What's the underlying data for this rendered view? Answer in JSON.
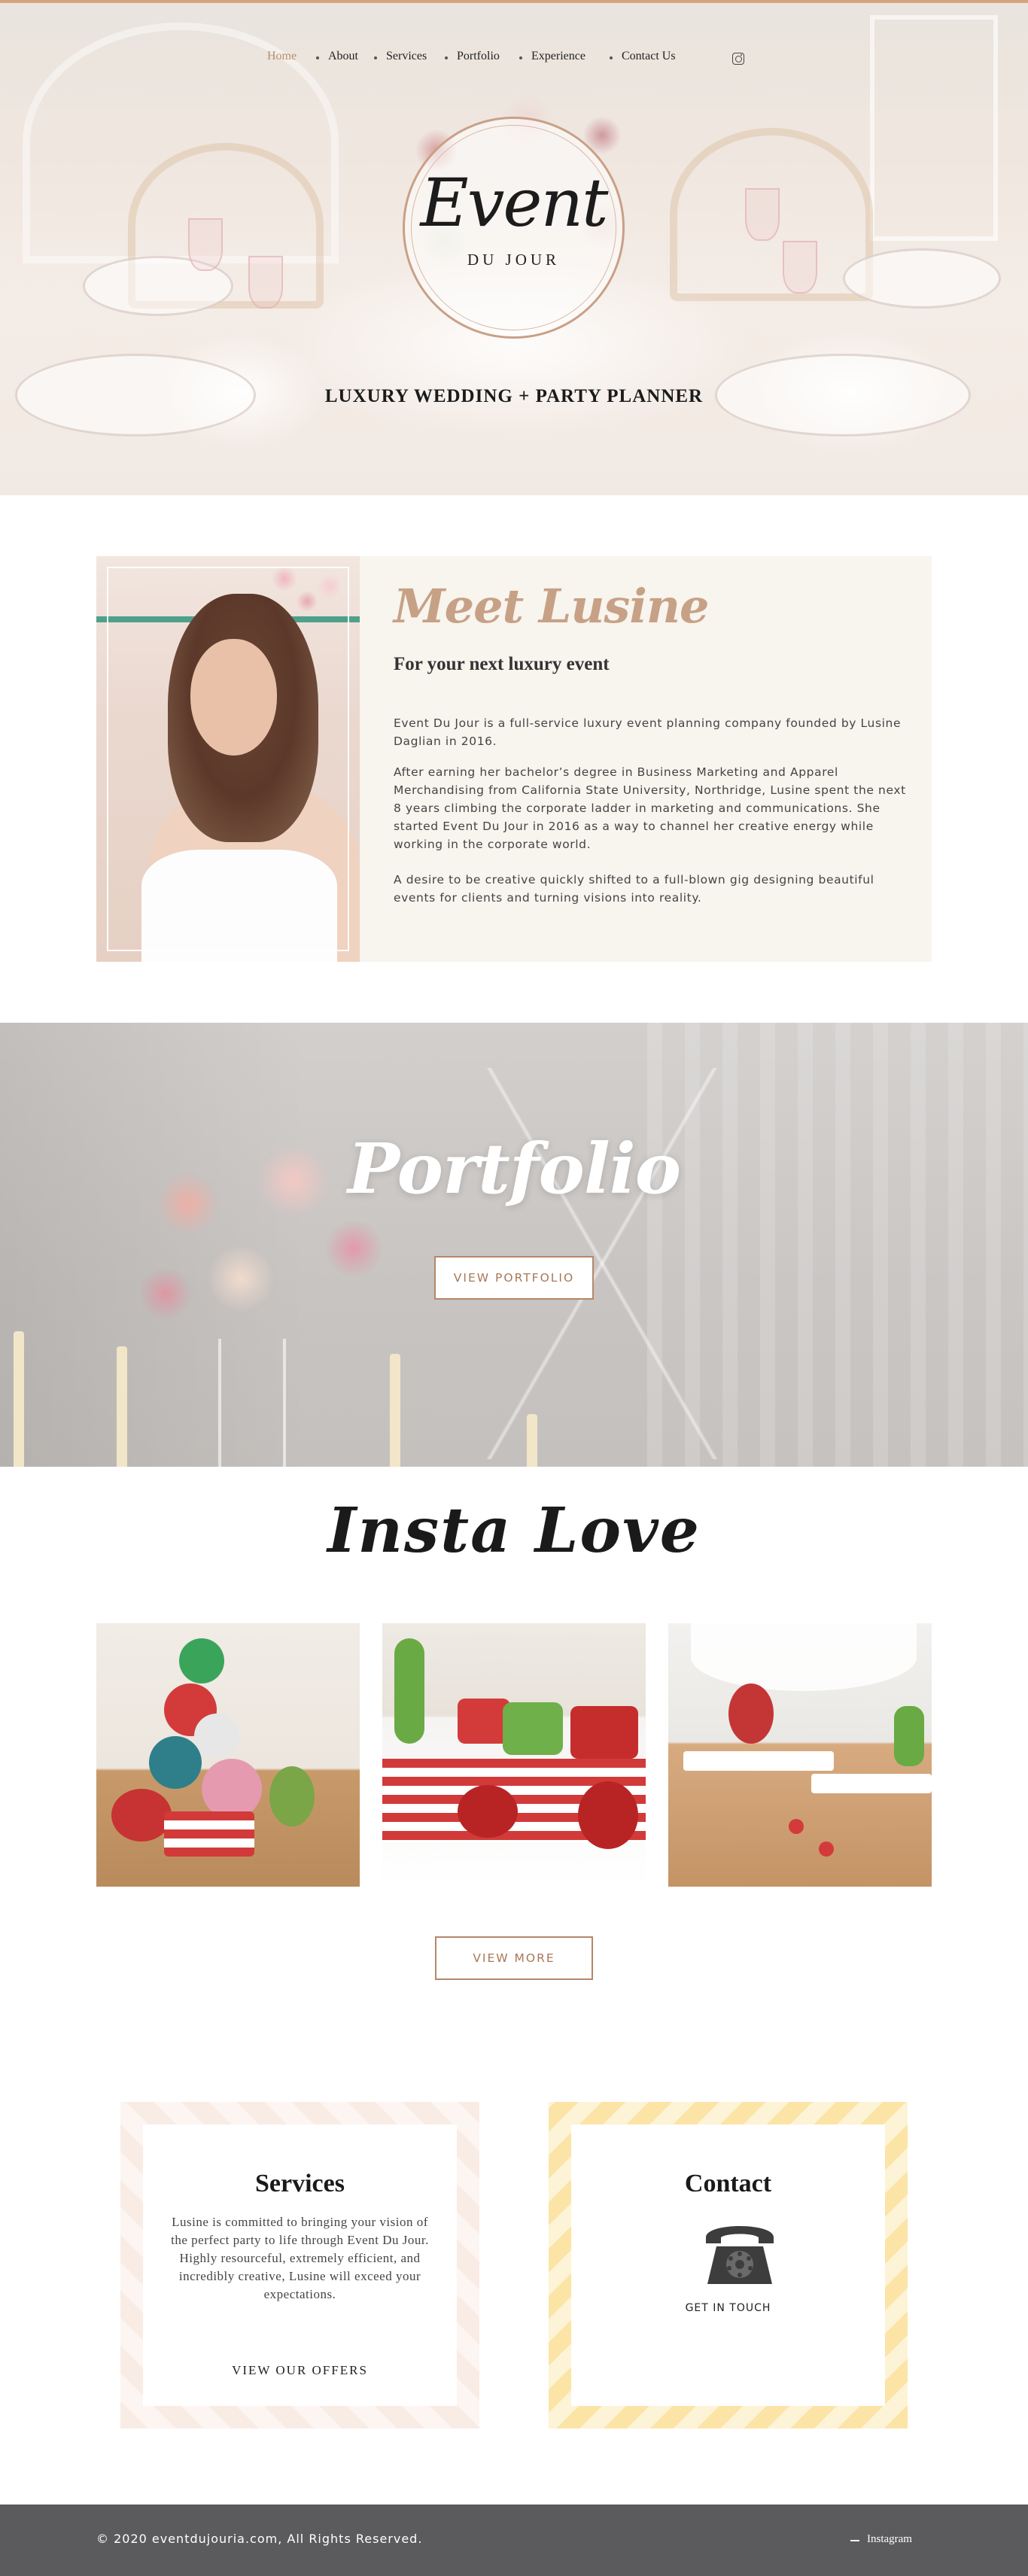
{
  "nav": {
    "items": [
      {
        "label": "Home",
        "active": true
      },
      {
        "label": "About"
      },
      {
        "label": "Services"
      },
      {
        "label": "Portfolio"
      },
      {
        "label": "Experience"
      },
      {
        "label": "Contact Us"
      }
    ],
    "social_icon": "instagram-icon"
  },
  "hero": {
    "logo_script": "Event",
    "logo_sub": "DU JOUR",
    "tagline": "LUXURY WEDDING + PARTY PLANNER"
  },
  "about": {
    "title": "Meet Lusine",
    "subtitle": "For your next luxury event",
    "paragraphs": [
      "Event Du Jour is a full-service luxury event planning company founded by Lusine Daglian in 2016.",
      "After earning her bachelor’s degree in Business Marketing and Apparel Merchandising from California State University, Northridge, Lusine spent the next 8 years climbing the corporate ladder in marketing and communications. She started Event Du Jour in 2016 as a way to channel her creative energy while working in the corporate world.",
      "A desire to be creative quickly shifted to a full-blown gig designing beautiful events for clients and turning visions into reality."
    ]
  },
  "portfolio": {
    "title": "Portfolio",
    "button_label": "VIEW PORTFOLIO"
  },
  "insta": {
    "title": "Insta Love",
    "button_label": "VIEW MORE"
  },
  "services_card": {
    "title": "Services",
    "text": "Lusine is committed to bringing your vision of the perfect party to life through Event Du Jour. Highly resourceful, extremely efficient, and incredibly creative, Lusine will exceed your expectations.",
    "link_label": "VIEW OUR OFFERS"
  },
  "contact_card": {
    "title": "Contact",
    "icon": "telephone-icon",
    "link_label": "GET IN TOUCH"
  },
  "footer": {
    "copyright": "© 2020 eventdujouria.com, All Rights Reserved.",
    "social_label": "Instagram"
  },
  "colors": {
    "accent": "#b5876a",
    "footer_bg": "#5b5b5e",
    "about_bg": "#f8f4ee"
  }
}
